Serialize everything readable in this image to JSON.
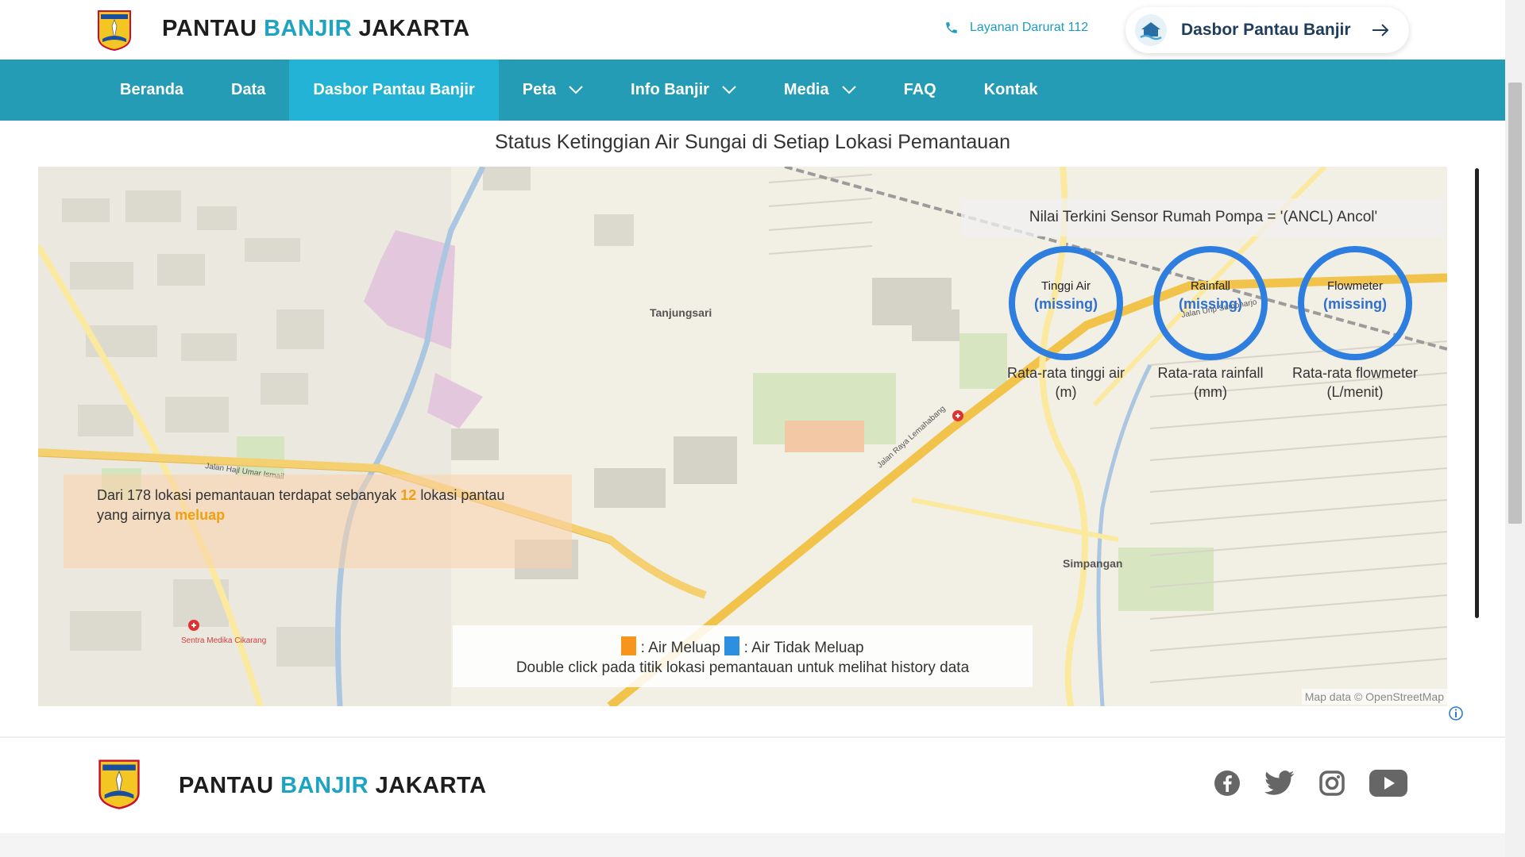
{
  "header": {
    "brand": {
      "part1": "PANTAU",
      "part2": "BANJIR",
      "part3": "JAKARTA"
    },
    "emergency_label": "Layanan Darurat 112",
    "dashboard_button": "Dasbor Pantau Banjir"
  },
  "nav": {
    "items": [
      {
        "label": "Beranda"
      },
      {
        "label": "Data"
      },
      {
        "label": "Dasbor Pantau Banjir",
        "active": true
      },
      {
        "label": "Peta",
        "dropdown": true
      },
      {
        "label": "Info Banjir",
        "dropdown": true
      },
      {
        "label": "Media",
        "dropdown": true
      },
      {
        "label": "FAQ"
      },
      {
        "label": "Kontak"
      }
    ]
  },
  "main": {
    "title": "Status Ketinggian Air Sungai di Setiap Lokasi Pemantauan",
    "map": {
      "sensor_title": "Nilai Terkini Sensor Rumah Pompa = '(ANCL) Ancol'",
      "gauges": [
        {
          "name": "Tinggi Air",
          "value": "(missing)",
          "caption1": "Rata-rata tinggi air",
          "caption2": "(m)"
        },
        {
          "name": "Rainfall",
          "value": "(missing)",
          "caption1": "Rata-rata rainfall",
          "caption2": "(mm)"
        },
        {
          "name": "Flowmeter",
          "value": "(missing)",
          "caption1": "Rata-rata flowmeter",
          "caption2": "(L/menit)"
        }
      ],
      "summary": {
        "prefix": "Dari 178 lokasi pemantauan terdapat sebanyak",
        "count": "12",
        "middle": "lokasi pantau yang airnya",
        "status": "meluap"
      },
      "legend": {
        "overflow_label": ": Air Meluap",
        "normal_label": ": Air Tidak Meluap",
        "hint": "Double click pada titik lokasi pemantauan untuk melihat history data",
        "overflow_color": "#f7941d",
        "normal_color": "#2d8fe0"
      },
      "attribution": "Map data © OpenStreetMap",
      "place_labels": [
        "Tanjungsari",
        "Simpangan",
        "Sentra Medika Cikarang"
      ],
      "road_labels": [
        "Jalan Hajl Umar Ismail",
        "Jalan Raya Lemahabang",
        "Jalan Urip Sumoharjo"
      ]
    }
  },
  "footer": {
    "brand": {
      "part1": "PANTAU",
      "part2": "BANJIR",
      "part3": "JAKARTA"
    },
    "socials": [
      "facebook-icon",
      "twitter-icon",
      "instagram-icon",
      "youtube-icon"
    ]
  }
}
